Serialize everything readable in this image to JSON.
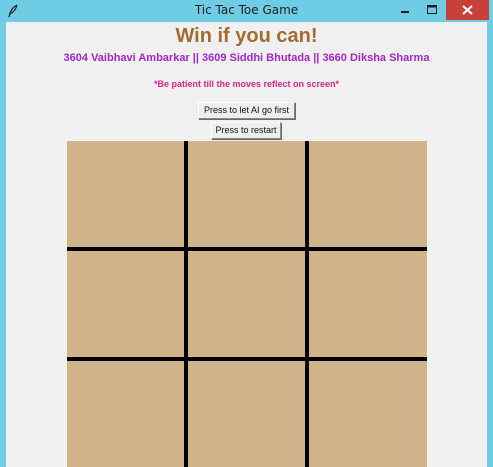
{
  "window": {
    "title": "Tic Tac Toe Game"
  },
  "titlebar": {
    "app_icon": "feather-icon",
    "minimize_icon": "minimize-icon",
    "maximize_icon": "maximize-icon",
    "close_icon": "close-icon",
    "close_color": "#c7403a",
    "frame_color": "#6ecde4"
  },
  "main": {
    "heading": "Win if you can!",
    "authors": "3604 Vaibhavi Ambarkar || 3609 Siddhi Bhutada || 3660 Diksha  Sharma",
    "note": "*Be patient till the moves reflect on screen*",
    "ai_first_button": "Press to let AI go first",
    "restart_button": "Press to restart"
  },
  "colors": {
    "heading": "#a36b2c",
    "authors": "#a327c4",
    "note": "#d4288b",
    "board": "#d2b48c",
    "grid_lines": "#000000"
  },
  "board": {
    "rows": 3,
    "cols": 3,
    "cells": [
      "",
      "",
      "",
      "",
      "",
      "",
      "",
      "",
      ""
    ]
  }
}
